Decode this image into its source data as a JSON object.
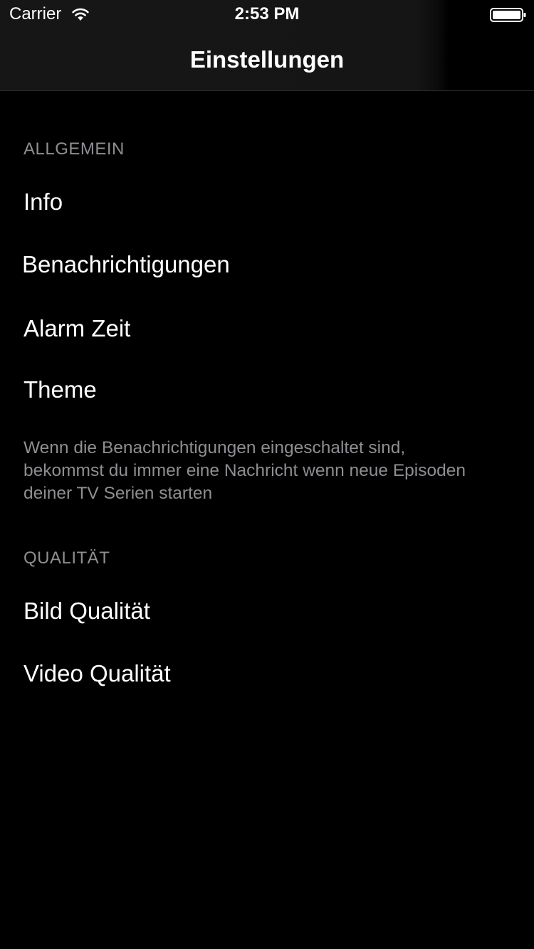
{
  "status_bar": {
    "carrier": "Carrier",
    "time": "2:53 PM",
    "wifi_icon": "wifi-icon",
    "battery_icon": "battery-icon"
  },
  "nav": {
    "title": "Einstellungen"
  },
  "sections": [
    {
      "header": "ALLGEMEIN",
      "rows": [
        {
          "label": "Info"
        },
        {
          "label": "Benachrichtigungen"
        },
        {
          "label": "Alarm Zeit"
        },
        {
          "label": "Theme"
        }
      ],
      "footer": "Wenn die Benachrichtigungen eingeschaltet sind, bekommst du immer eine Nachricht wenn neue Episoden deiner TV Serien starten"
    },
    {
      "header": "QUALITÄT",
      "rows": [
        {
          "label": "Bild Qualität"
        },
        {
          "label": "Video Qualität"
        }
      ]
    }
  ],
  "colors": {
    "background": "#000000",
    "text": "#ffffff",
    "secondary_text": "#8e8e93",
    "header_background": "#151515"
  }
}
